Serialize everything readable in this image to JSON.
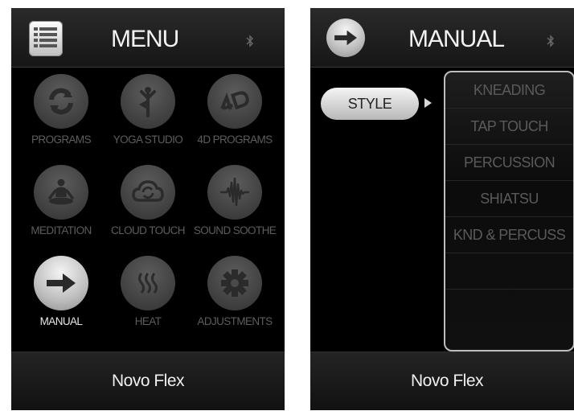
{
  "left_screen": {
    "title": "MENU",
    "tiles": [
      {
        "label": "PROGRAMS"
      },
      {
        "label": "YOGA STUDIO"
      },
      {
        "label": "4D PROGRAMS"
      },
      {
        "label": "MEDITATION"
      },
      {
        "label": "CLOUD TOUCH"
      },
      {
        "label": "SOUND SOOTHE"
      },
      {
        "label": "MANUAL"
      },
      {
        "label": "HEAT"
      },
      {
        "label": "ADJUSTMENTS"
      }
    ],
    "footer": "Novo Flex"
  },
  "right_screen": {
    "title": "MANUAL",
    "style_button": "STYLE",
    "styles": [
      "KNEADING",
      "TAP TOUCH",
      "PERCUSSION",
      "SHIATSU",
      "KND & PERCUSS"
    ],
    "footer": "Novo Flex"
  },
  "icons": [
    "menu-list-icon",
    "bluetooth-icon",
    "refresh-icon",
    "yoga-icon",
    "4d-icon",
    "meditation-icon",
    "cloud-icon",
    "sound-wave-icon",
    "arrow-right-icon",
    "heat-icon",
    "gear-icon"
  ],
  "colors": {
    "background": "#000000",
    "active": "#e6e6e6",
    "inactive": "#5d5d5d"
  }
}
